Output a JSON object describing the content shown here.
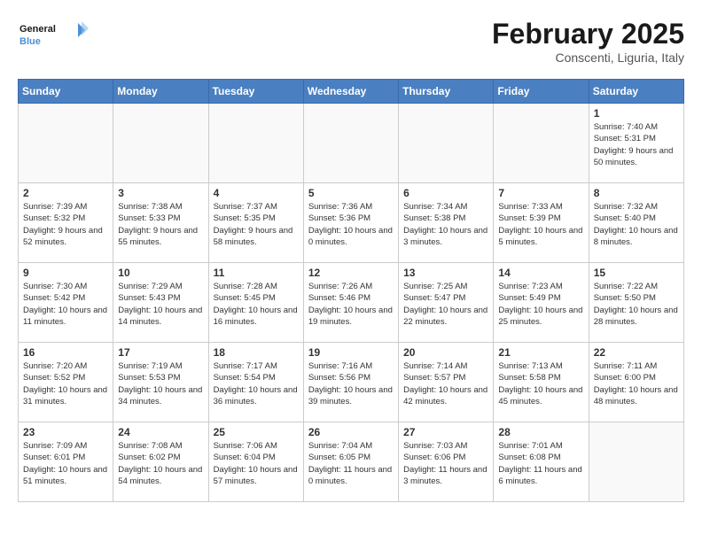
{
  "header": {
    "logo_general": "General",
    "logo_blue": "Blue",
    "title": "February 2025",
    "subtitle": "Conscenti, Liguria, Italy"
  },
  "days_of_week": [
    "Sunday",
    "Monday",
    "Tuesday",
    "Wednesday",
    "Thursday",
    "Friday",
    "Saturday"
  ],
  "weeks": [
    [
      {
        "day": "",
        "info": ""
      },
      {
        "day": "",
        "info": ""
      },
      {
        "day": "",
        "info": ""
      },
      {
        "day": "",
        "info": ""
      },
      {
        "day": "",
        "info": ""
      },
      {
        "day": "",
        "info": ""
      },
      {
        "day": "1",
        "info": "Sunrise: 7:40 AM\nSunset: 5:31 PM\nDaylight: 9 hours and 50 minutes."
      }
    ],
    [
      {
        "day": "2",
        "info": "Sunrise: 7:39 AM\nSunset: 5:32 PM\nDaylight: 9 hours and 52 minutes."
      },
      {
        "day": "3",
        "info": "Sunrise: 7:38 AM\nSunset: 5:33 PM\nDaylight: 9 hours and 55 minutes."
      },
      {
        "day": "4",
        "info": "Sunrise: 7:37 AM\nSunset: 5:35 PM\nDaylight: 9 hours and 58 minutes."
      },
      {
        "day": "5",
        "info": "Sunrise: 7:36 AM\nSunset: 5:36 PM\nDaylight: 10 hours and 0 minutes."
      },
      {
        "day": "6",
        "info": "Sunrise: 7:34 AM\nSunset: 5:38 PM\nDaylight: 10 hours and 3 minutes."
      },
      {
        "day": "7",
        "info": "Sunrise: 7:33 AM\nSunset: 5:39 PM\nDaylight: 10 hours and 5 minutes."
      },
      {
        "day": "8",
        "info": "Sunrise: 7:32 AM\nSunset: 5:40 PM\nDaylight: 10 hours and 8 minutes."
      }
    ],
    [
      {
        "day": "9",
        "info": "Sunrise: 7:30 AM\nSunset: 5:42 PM\nDaylight: 10 hours and 11 minutes."
      },
      {
        "day": "10",
        "info": "Sunrise: 7:29 AM\nSunset: 5:43 PM\nDaylight: 10 hours and 14 minutes."
      },
      {
        "day": "11",
        "info": "Sunrise: 7:28 AM\nSunset: 5:45 PM\nDaylight: 10 hours and 16 minutes."
      },
      {
        "day": "12",
        "info": "Sunrise: 7:26 AM\nSunset: 5:46 PM\nDaylight: 10 hours and 19 minutes."
      },
      {
        "day": "13",
        "info": "Sunrise: 7:25 AM\nSunset: 5:47 PM\nDaylight: 10 hours and 22 minutes."
      },
      {
        "day": "14",
        "info": "Sunrise: 7:23 AM\nSunset: 5:49 PM\nDaylight: 10 hours and 25 minutes."
      },
      {
        "day": "15",
        "info": "Sunrise: 7:22 AM\nSunset: 5:50 PM\nDaylight: 10 hours and 28 minutes."
      }
    ],
    [
      {
        "day": "16",
        "info": "Sunrise: 7:20 AM\nSunset: 5:52 PM\nDaylight: 10 hours and 31 minutes."
      },
      {
        "day": "17",
        "info": "Sunrise: 7:19 AM\nSunset: 5:53 PM\nDaylight: 10 hours and 34 minutes."
      },
      {
        "day": "18",
        "info": "Sunrise: 7:17 AM\nSunset: 5:54 PM\nDaylight: 10 hours and 36 minutes."
      },
      {
        "day": "19",
        "info": "Sunrise: 7:16 AM\nSunset: 5:56 PM\nDaylight: 10 hours and 39 minutes."
      },
      {
        "day": "20",
        "info": "Sunrise: 7:14 AM\nSunset: 5:57 PM\nDaylight: 10 hours and 42 minutes."
      },
      {
        "day": "21",
        "info": "Sunrise: 7:13 AM\nSunset: 5:58 PM\nDaylight: 10 hours and 45 minutes."
      },
      {
        "day": "22",
        "info": "Sunrise: 7:11 AM\nSunset: 6:00 PM\nDaylight: 10 hours and 48 minutes."
      }
    ],
    [
      {
        "day": "23",
        "info": "Sunrise: 7:09 AM\nSunset: 6:01 PM\nDaylight: 10 hours and 51 minutes."
      },
      {
        "day": "24",
        "info": "Sunrise: 7:08 AM\nSunset: 6:02 PM\nDaylight: 10 hours and 54 minutes."
      },
      {
        "day": "25",
        "info": "Sunrise: 7:06 AM\nSunset: 6:04 PM\nDaylight: 10 hours and 57 minutes."
      },
      {
        "day": "26",
        "info": "Sunrise: 7:04 AM\nSunset: 6:05 PM\nDaylight: 11 hours and 0 minutes."
      },
      {
        "day": "27",
        "info": "Sunrise: 7:03 AM\nSunset: 6:06 PM\nDaylight: 11 hours and 3 minutes."
      },
      {
        "day": "28",
        "info": "Sunrise: 7:01 AM\nSunset: 6:08 PM\nDaylight: 11 hours and 6 minutes."
      },
      {
        "day": "",
        "info": ""
      }
    ]
  ]
}
